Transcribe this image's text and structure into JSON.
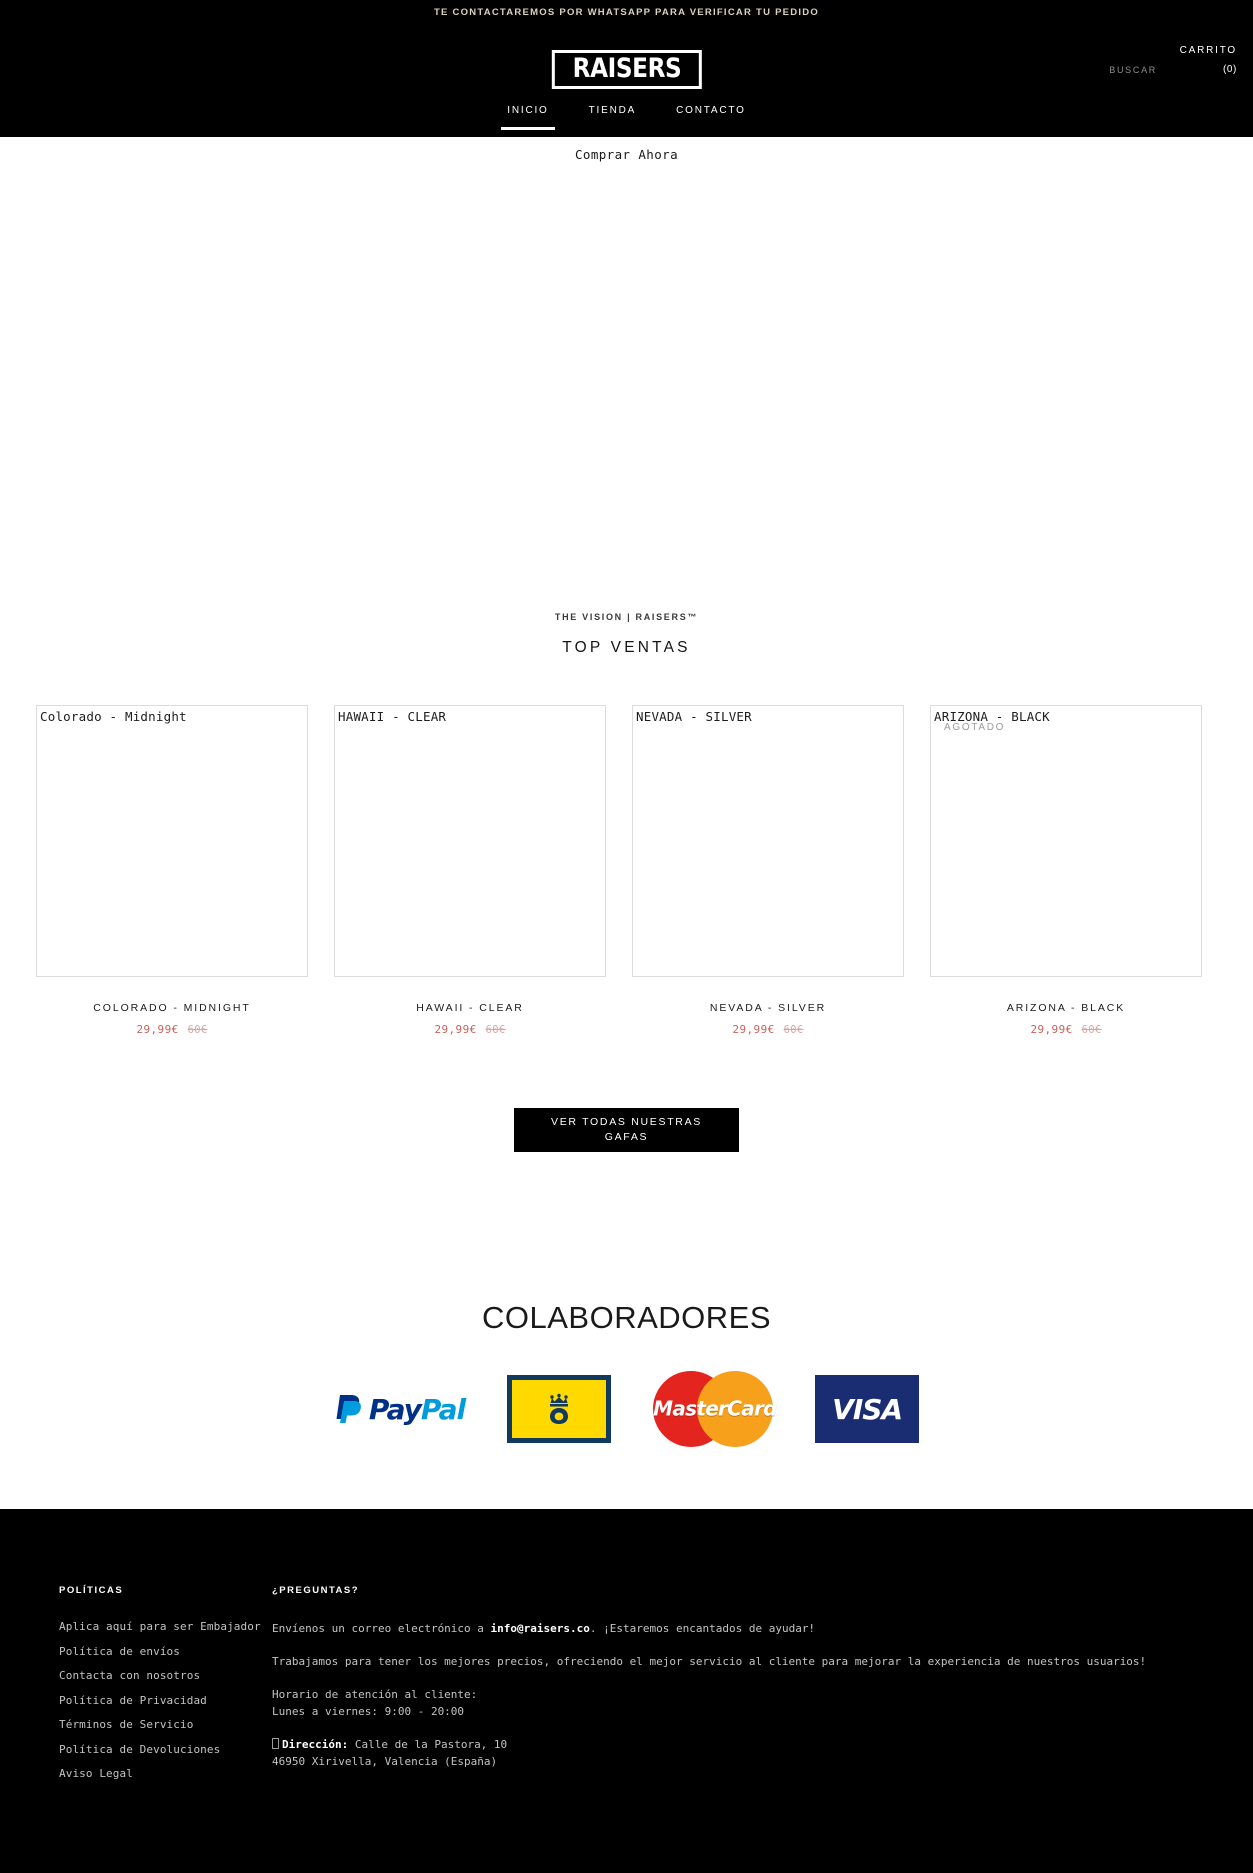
{
  "announcement": {
    "text": "TE CONTACTAREMOS POR WHATSAPP PARA VERIFICAR TU PEDIDO",
    "text_color": "#d8d3bd",
    "background": "#000000"
  },
  "header": {
    "logo_text": "RAISERS",
    "cart_label": "CARRITO",
    "cart_count": "(0)",
    "search_label": "BUSCAR",
    "nav": [
      {
        "label": "INICIO",
        "active": true
      },
      {
        "label": "TIENDA",
        "active": false
      },
      {
        "label": "CONTACTO",
        "active": false
      }
    ]
  },
  "hero": {
    "buy_now_label": "Comprar Ahora"
  },
  "top_sales": {
    "eyebrow": "THE VISION | RAISERS™",
    "title": "TOP VENTAS",
    "products": [
      {
        "alt_text": "Colorado - Midnight",
        "name": "COLORADO - MIDNIGHT",
        "price_sale": "29,99€",
        "price_old": "60€",
        "sold_out": false,
        "sold_out_label": ""
      },
      {
        "alt_text": "HAWAII - CLEAR",
        "name": "HAWAII - CLEAR",
        "price_sale": "29,99€",
        "price_old": "60€",
        "sold_out": false,
        "sold_out_label": ""
      },
      {
        "alt_text": "NEVADA - SILVER",
        "name": "NEVADA - SILVER",
        "price_sale": "29,99€",
        "price_old": "60€",
        "sold_out": false,
        "sold_out_label": ""
      },
      {
        "alt_text": "ARIZONA - BLACK",
        "name": "ARIZONA - BLACK",
        "price_sale": "29,99€",
        "price_old": "60€",
        "sold_out": true,
        "sold_out_label": "AGOTADO"
      }
    ],
    "cta_line1": "VER TODAS NUESTRAS",
    "cta_line2": "GAFAS",
    "sale_price_color": "#c9625e",
    "old_price_color": "#d9a6a3"
  },
  "collaborators": {
    "title": "COLABORADORES",
    "logos": [
      {
        "name": "paypal",
        "pay": "Pay",
        "pal": "Pal"
      },
      {
        "name": "correos",
        "glyph": "♚"
      },
      {
        "name": "mastercard",
        "word": "MasterCard"
      },
      {
        "name": "visa",
        "word": "VISA"
      }
    ]
  },
  "footer": {
    "policies_heading": "POLÍTICAS",
    "policies_links": [
      "Aplica aquí para ser Embajador",
      "Política de envíos",
      "Contacta con nosotros",
      "Política de Privacidad",
      "Términos de Servicio",
      "Política de Devoluciones",
      "Aviso Legal"
    ],
    "questions_heading": "¿PREGUNTAS?",
    "email_intro": "Envíenos un correo electrónico a ",
    "email": "info@raisers.co",
    "email_outro": ". ¡Estaremos encantados de ayudar!",
    "mission": "Trabajamos para tener los mejores precios, ofreciendo el mejor servicio al cliente para mejorar la experiencia de nuestros usuarios!",
    "hours_label": "Horario de atención al cliente:",
    "hours_value": "Lunes a viernes: 9:00 - 20:00",
    "address_label": "Dirección:",
    "address_street": " Calle de la Pastora, 10",
    "address_city": "46950 Xirivella, Valencia (España)"
  }
}
